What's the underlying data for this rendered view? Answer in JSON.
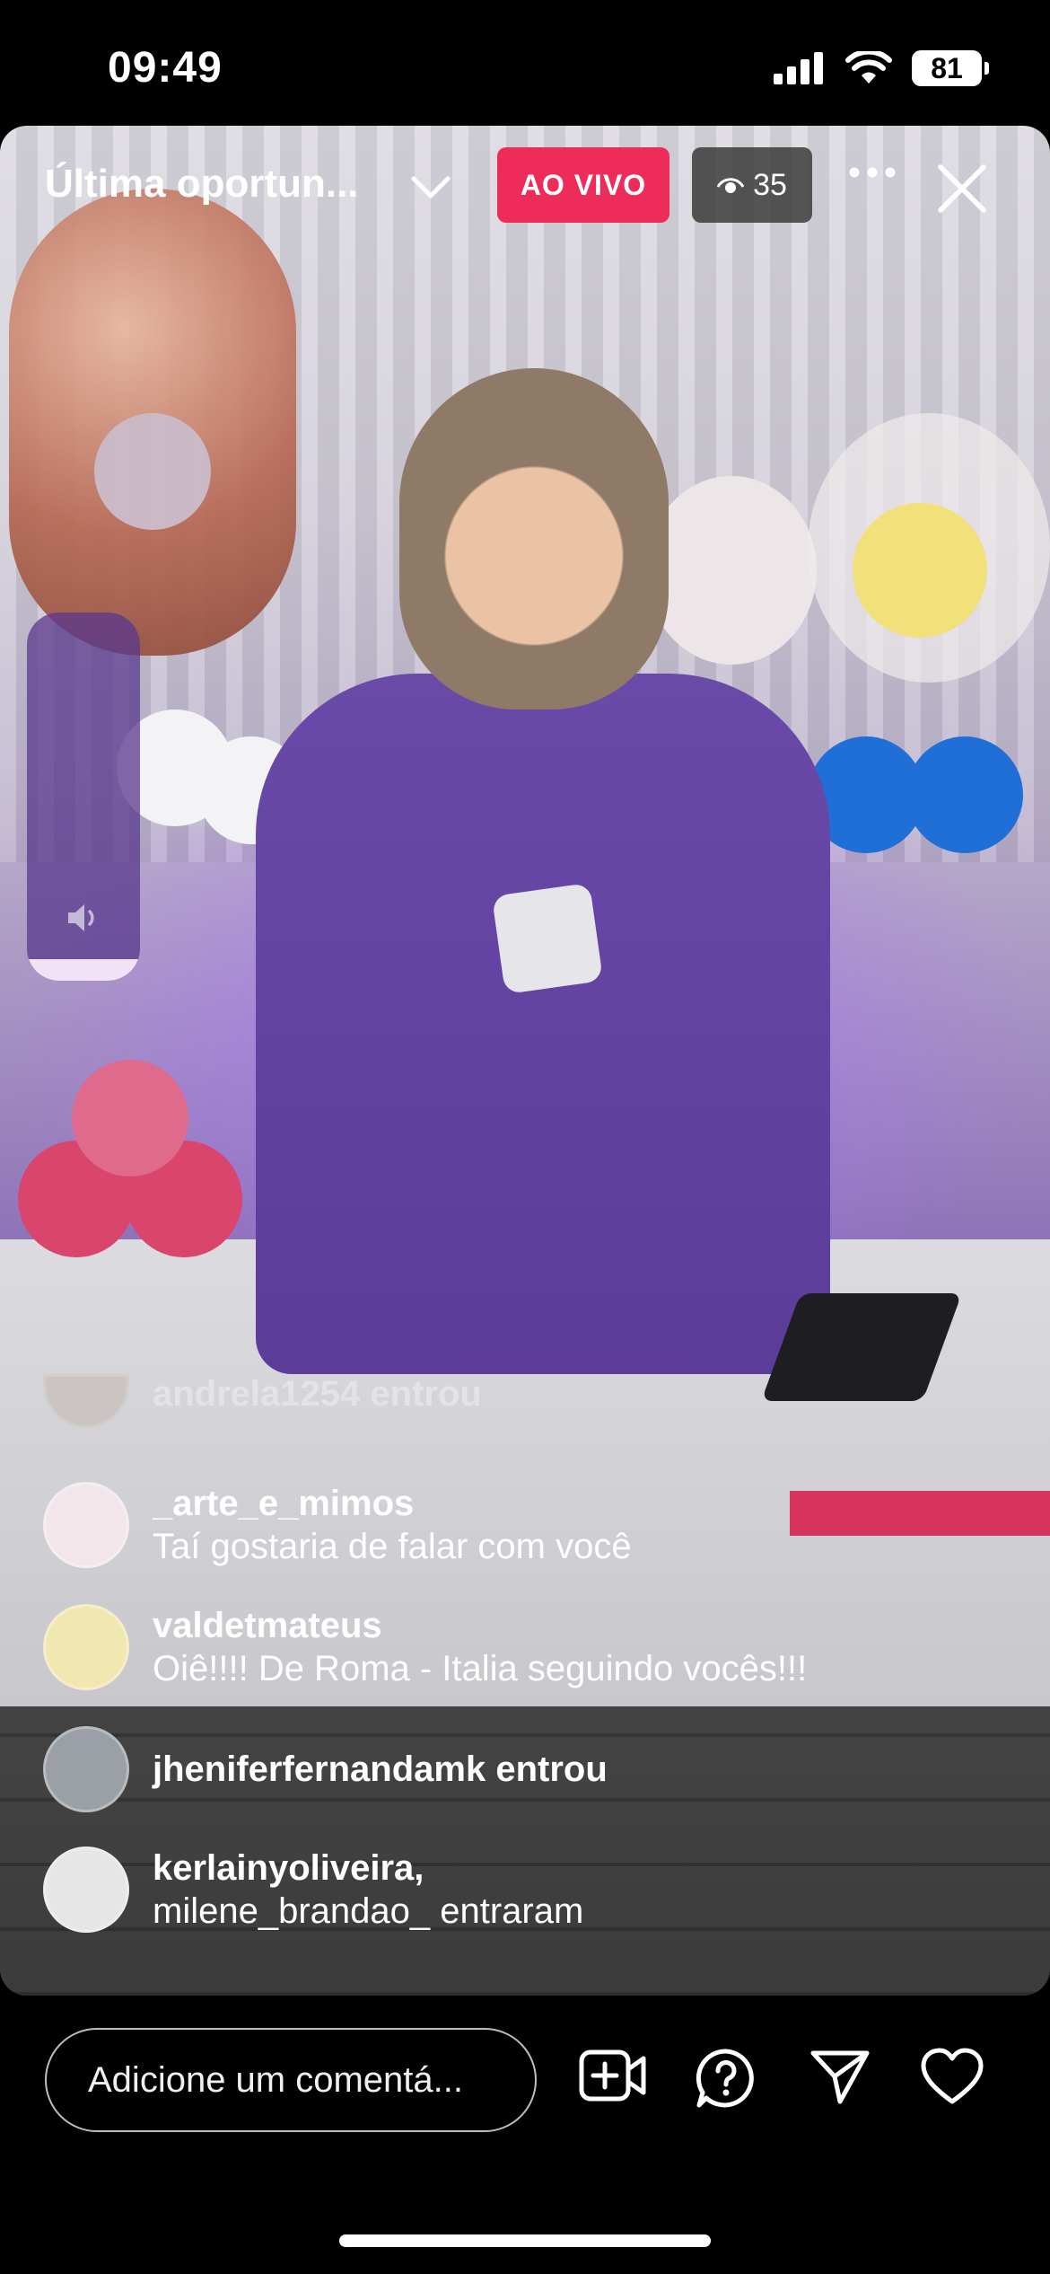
{
  "status_bar": {
    "time": "09:49",
    "battery": "81"
  },
  "live": {
    "title": "Última oportun...",
    "badge": "AO VIVO",
    "viewers": "35"
  },
  "comments": [
    {
      "type": "faded",
      "text": "andrela1254 entrou"
    },
    {
      "type": "comment",
      "user": "_arte_e_mimos",
      "text": "Taí gostaria de falar com você",
      "avatar_color": "#f3e6ea"
    },
    {
      "type": "comment",
      "user": "valdetmateus",
      "text": "Oiê!!!! De Roma - Italia seguindo vocês!!!",
      "avatar_color": "#f1e7b0"
    },
    {
      "type": "join",
      "text": "jheniferfernandamk entrou",
      "avatar_color": "#9aa0a6"
    },
    {
      "type": "multi",
      "line1": "kerlainyoliveira,",
      "line2": "milene_brandao_ entraram",
      "avatar_color": "#e6e6e6"
    }
  ],
  "composer": {
    "placeholder": "Adicione um comentá..."
  },
  "icons": [
    "signal-icon",
    "wifi-icon",
    "battery-icon",
    "chevron-down-icon",
    "eye-icon",
    "more-icon",
    "close-icon",
    "speaker-icon",
    "add-video-icon",
    "question-icon",
    "send-icon",
    "heart-icon"
  ]
}
